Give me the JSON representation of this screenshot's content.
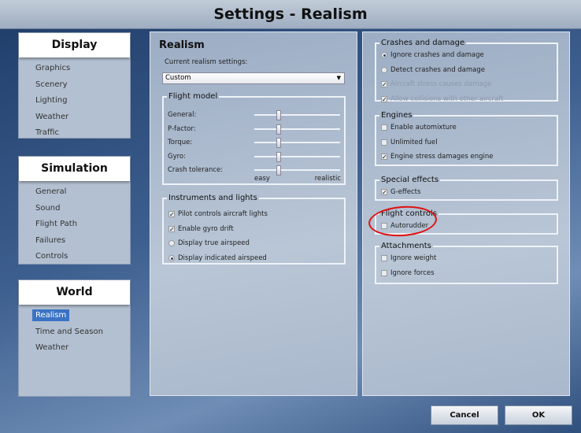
{
  "window": {
    "title": "Settings - Realism"
  },
  "sidebar": {
    "sections": [
      {
        "title": "Display",
        "items": [
          "Graphics",
          "Scenery",
          "Lighting",
          "Weather",
          "Traffic"
        ]
      },
      {
        "title": "Simulation",
        "items": [
          "General",
          "Sound",
          "Flight Path",
          "Failures",
          "Controls"
        ]
      },
      {
        "title": "World",
        "items": [
          "Realism",
          "Time and Season",
          "Weather"
        ],
        "selected": "Realism"
      }
    ]
  },
  "realism": {
    "title": "Realism",
    "current_label": "Current realism settings:",
    "preset": "Custom",
    "flight_model": {
      "legend": "Flight model",
      "sliders": [
        {
          "label": "General:",
          "value": 0.28
        },
        {
          "label": "P-factor:",
          "value": 0.28
        },
        {
          "label": "Torque:",
          "value": 0.28
        },
        {
          "label": "Gyro:",
          "value": 0.28
        },
        {
          "label": "Crash tolerance:",
          "value": 0.28
        }
      ],
      "min_label": "easy",
      "max_label": "realistic"
    },
    "instruments": {
      "legend": "Instruments and lights",
      "items": [
        {
          "label": "Pilot controls aircraft lights",
          "type": "checkbox",
          "checked": true
        },
        {
          "label": "Enable gyro drift",
          "type": "checkbox",
          "checked": true
        },
        {
          "label": "Display true airspeed",
          "type": "radio",
          "checked": false
        },
        {
          "label": "Display indicated airspeed",
          "type": "radio",
          "checked": true
        }
      ]
    }
  },
  "groups": [
    {
      "legend": "Crashes and damage",
      "items": [
        {
          "label": "Ignore crashes and damage",
          "type": "radio",
          "checked": true
        },
        {
          "label": "Detect crashes and damage",
          "type": "radio",
          "checked": false
        },
        {
          "label": "Aircraft stress causes damage",
          "type": "checkbox",
          "checked": true,
          "disabled": true
        },
        {
          "label": "Allow collisions with other aircraft",
          "type": "checkbox",
          "checked": true,
          "disabled": true
        }
      ]
    },
    {
      "legend": "Engines",
      "items": [
        {
          "label": "Enable automixture",
          "type": "checkbox",
          "checked": false
        },
        {
          "label": "Unlimited fuel",
          "type": "checkbox",
          "checked": false
        },
        {
          "label": "Engine stress damages engine",
          "type": "checkbox",
          "checked": true
        }
      ]
    },
    {
      "legend": "Special effects",
      "items": [
        {
          "label": "G-effects",
          "type": "checkbox",
          "checked": true
        }
      ]
    },
    {
      "legend": "Flight controls",
      "items": [
        {
          "label": "Autorudder",
          "type": "checkbox",
          "checked": false
        }
      ]
    },
    {
      "legend": "Attachments",
      "items": [
        {
          "label": "Ignore weight",
          "type": "checkbox",
          "checked": false
        },
        {
          "label": "Ignore forces",
          "type": "checkbox",
          "checked": false
        }
      ]
    }
  ],
  "buttons": {
    "cancel": "Cancel",
    "ok": "OK"
  },
  "colors": {
    "selection": "#3a73c4",
    "annotation": "#e01010"
  }
}
